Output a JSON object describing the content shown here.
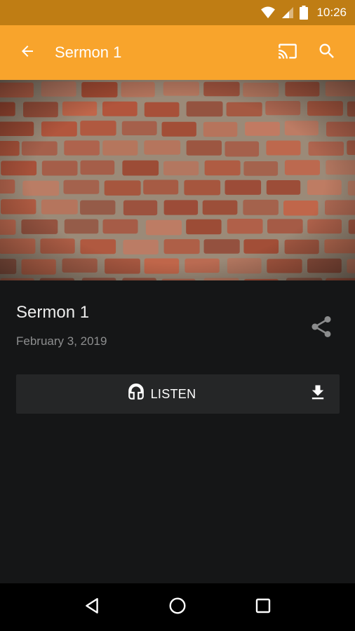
{
  "status_bar": {
    "time": "10:26",
    "icons": [
      "wifi-icon",
      "cell-signal-icon",
      "battery-icon"
    ]
  },
  "app_bar": {
    "title": "Sermon 1",
    "background": "#f8a42c",
    "icons": [
      "back-arrow-icon",
      "cast-icon",
      "search-icon"
    ]
  },
  "hero": {
    "image": "brick-wall"
  },
  "sermon": {
    "title": "Sermon 1",
    "date": "February 3, 2019",
    "listen_label": "LISTEN",
    "icons": [
      "share-icon",
      "headphones-icon",
      "download-icon"
    ]
  },
  "nav_bar": {
    "icons": [
      "back-triangle-icon",
      "home-circle-icon",
      "recents-square-icon"
    ]
  },
  "colors": {
    "accent": "#f8a42c",
    "status_bar": "#bf7d14",
    "background": "#151617",
    "button_bg": "#252627"
  }
}
